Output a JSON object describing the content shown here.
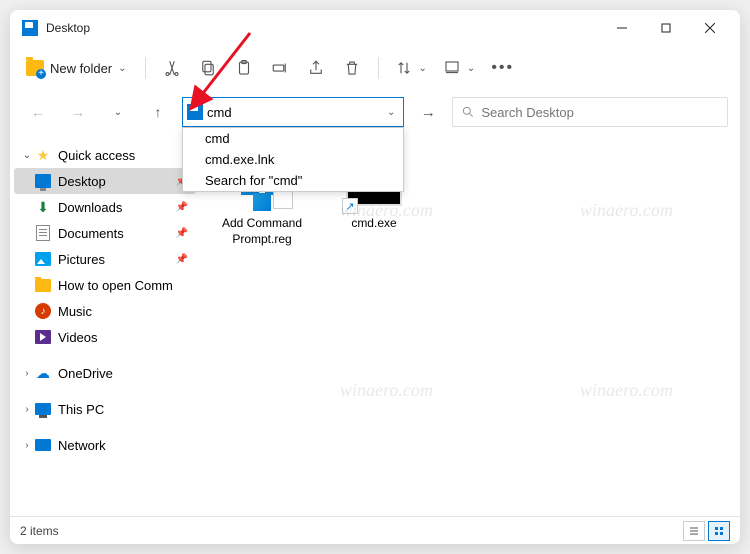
{
  "window": {
    "title": "Desktop"
  },
  "toolbar": {
    "new_label": "New folder",
    "more_label": "…"
  },
  "address": {
    "value": "cmd",
    "dropdown": [
      "cmd",
      "cmd.exe.lnk",
      "Search for \"cmd\""
    ]
  },
  "search": {
    "placeholder": "Search Desktop"
  },
  "sidebar": {
    "quick_access": "Quick access",
    "items": [
      {
        "label": "Desktop",
        "pinned": true,
        "selected": true
      },
      {
        "label": "Downloads",
        "pinned": true
      },
      {
        "label": "Documents",
        "pinned": true
      },
      {
        "label": "Pictures",
        "pinned": true
      },
      {
        "label": "How to open Comm",
        "pinned": false
      },
      {
        "label": "Music",
        "pinned": false
      },
      {
        "label": "Videos",
        "pinned": false
      }
    ],
    "onedrive": "OneDrive",
    "thispc": "This PC",
    "network": "Network"
  },
  "files": [
    {
      "label": "Add Command Prompt.reg",
      "type": "reg"
    },
    {
      "label": "cmd.exe",
      "type": "shortcut"
    }
  ],
  "status": {
    "count": "2 items"
  },
  "watermark": "winaero.com"
}
